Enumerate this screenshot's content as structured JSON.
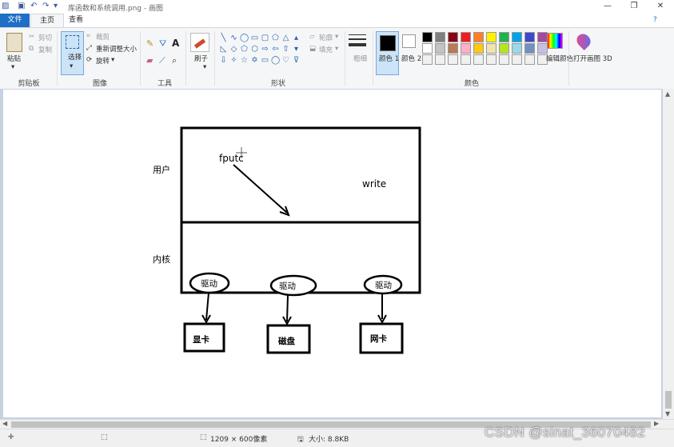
{
  "window": {
    "title": "库函数和系统调用.png - 画图"
  },
  "tabs": {
    "file": "文件",
    "home": "主页",
    "view": "查看"
  },
  "ribbon": {
    "clipboard": {
      "paste": "粘贴",
      "cut": "剪切",
      "copy": "复制",
      "group": "剪贴板"
    },
    "image": {
      "select": "选择",
      "crop": "裁剪",
      "resize": "重新调整大小",
      "rotate": "旋转",
      "group": "图像"
    },
    "tools": {
      "group": "工具"
    },
    "brushes": {
      "label": "刷子"
    },
    "shapes": {
      "outline": "轮廓",
      "fill": "填充",
      "group": "形状"
    },
    "size": {
      "label": "粗细"
    },
    "colors": {
      "color1": "颜色 1",
      "color2": "颜色 2",
      "edit": "编辑颜色",
      "group": "颜色",
      "palette_row1": [
        "#000000",
        "#7f7f7f",
        "#880015",
        "#ed1c24",
        "#ff7f27",
        "#fff200",
        "#22b14c",
        "#00a2e8",
        "#3f48cc",
        "#a349a4"
      ],
      "palette_row2": [
        "#ffffff",
        "#c3c3c3",
        "#b97a57",
        "#ffaec9",
        "#ffc90e",
        "#efe4b0",
        "#b5e61d",
        "#99d9ea",
        "#7092be",
        "#c8bfe7"
      ]
    },
    "paint3d": {
      "label": "打开画图 3D"
    }
  },
  "drawing": {
    "user_label": "用户",
    "kernel_label": "内核",
    "fputc": "fputc",
    "write": "write",
    "drivers": [
      "驱动",
      "驱动",
      "驱动"
    ],
    "devices": [
      "显卡",
      "磁盘",
      "网卡"
    ]
  },
  "status": {
    "dimensions": "1209 × 600像素",
    "filesize": "大小: 8.8KB"
  },
  "watermark": "CSDN @sinat_36070482"
}
